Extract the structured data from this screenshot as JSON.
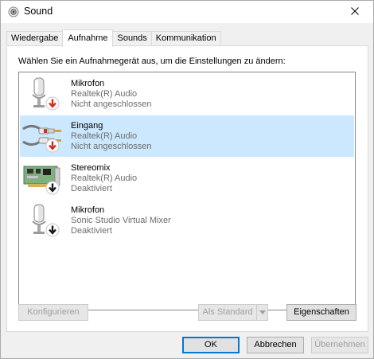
{
  "window": {
    "title": "Sound",
    "close_icon": "close-icon"
  },
  "tabs": [
    {
      "label": "Wiedergabe",
      "active": false
    },
    {
      "label": "Aufnahme",
      "active": true
    },
    {
      "label": "Sounds",
      "active": false
    },
    {
      "label": "Kommunikation",
      "active": false
    }
  ],
  "panel": {
    "instruction": "Wählen Sie ein Aufnahmegerät aus, um die Einstellungen zu ändern:"
  },
  "devices": [
    {
      "name": "Mikrofon",
      "driver": "Realtek(R) Audio",
      "status": "Nicht angeschlossen",
      "icon": "microphone-icon",
      "badge": "red-down-arrow-icon",
      "selected": false
    },
    {
      "name": "Eingang",
      "driver": "Realtek(R) Audio",
      "status": "Nicht angeschlossen",
      "icon": "cable-jack-icon",
      "badge": "red-down-arrow-icon",
      "selected": true
    },
    {
      "name": "Stereomix",
      "driver": "Realtek(R) Audio",
      "status": "Deaktiviert",
      "icon": "sound-card-icon",
      "badge": "black-down-arrow-icon",
      "selected": false
    },
    {
      "name": "Mikrofon",
      "driver": "Sonic Studio Virtual Mixer",
      "status": "Deaktiviert",
      "icon": "microphone-icon",
      "badge": "black-down-arrow-icon",
      "selected": false
    }
  ],
  "buttons": {
    "configure": "Konfigurieren",
    "set_default": "Als Standard",
    "properties": "Eigenschaften",
    "ok": "OK",
    "cancel": "Abbrechen",
    "apply": "Übernehmen"
  },
  "colors": {
    "selection": "#cce8ff",
    "default_button_border": "#0078d7",
    "badge_red": "#d9291c"
  }
}
